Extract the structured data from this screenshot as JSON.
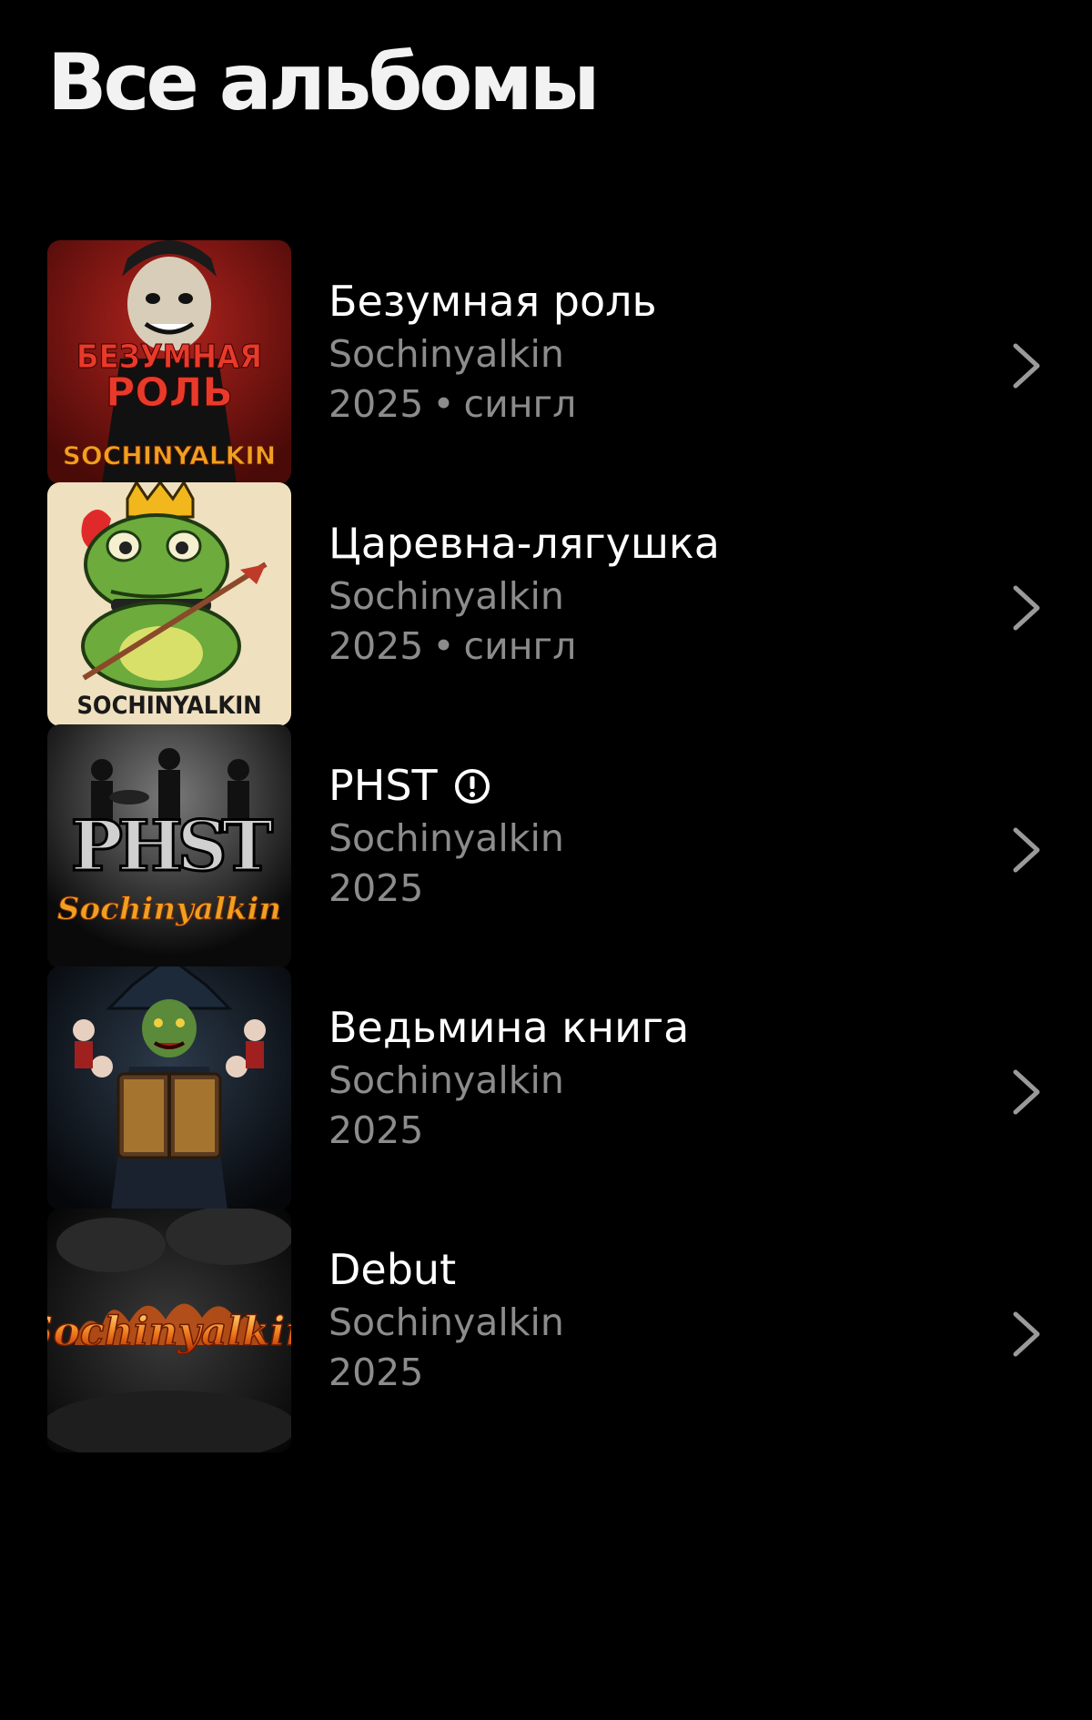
{
  "page": {
    "title": "Все альбомы"
  },
  "colors": {
    "background": "#000000",
    "title": "#f2f2f2",
    "secondary_text": "#8c8c8c",
    "chevron": "#9a9a9a"
  },
  "albums": [
    {
      "title": "Безумная роль",
      "artist": "Sochinyalkin",
      "year": "2025",
      "separator": "•",
      "kind": "сингл",
      "explicit": false,
      "cover_text": [
        "БЕЗУМНАЯ",
        "РОЛЬ",
        "SOCHINYALKIN"
      ]
    },
    {
      "title": "Царевна-лягушка",
      "artist": "Sochinyalkin",
      "year": "2025",
      "separator": "•",
      "kind": "сингл",
      "explicit": false,
      "cover_text": [
        "SOCHINYALKIN"
      ]
    },
    {
      "title": "PHST",
      "artist": "Sochinyalkin",
      "year": "2025",
      "separator": "",
      "kind": "",
      "explicit": true,
      "cover_text": [
        "PHST",
        "Sochinyalkin"
      ]
    },
    {
      "title": "Ведьмина книга",
      "artist": "Sochinyalkin",
      "year": "2025",
      "separator": "",
      "kind": "",
      "explicit": false,
      "cover_text": []
    },
    {
      "title": "Debut",
      "artist": "Sochinyalkin",
      "year": "2025",
      "separator": "",
      "kind": "",
      "explicit": false,
      "cover_text": [
        "Sochinyalkin"
      ]
    }
  ]
}
